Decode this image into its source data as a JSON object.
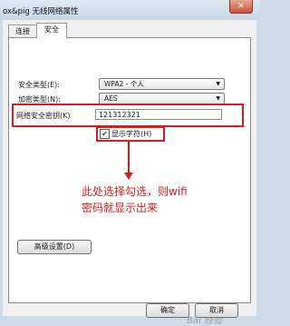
{
  "window": {
    "title": "ox&pig 无线网络属性",
    "close_glyph": "✕"
  },
  "tabs": [
    {
      "label": "连接"
    },
    {
      "label": "安全"
    }
  ],
  "security": {
    "type_label": "安全类型(E):",
    "type_value": "WPA2 - 个人",
    "encryption_label": "加密类型(N):",
    "encryption_value": "AES",
    "key_label": "网络安全密钥(K)",
    "key_value": "121312321",
    "show_chars_label": "显示字符(H)",
    "show_chars_checked": true
  },
  "annotation": {
    "line1": "此处选择勾选，则wifi",
    "line2": "密码就显示出来"
  },
  "buttons": {
    "advanced": "高级设置(D)",
    "ok": "确定",
    "cancel": "取消"
  },
  "watermark": "Bai 经验",
  "colors": {
    "highlight": "#d81b1b"
  }
}
